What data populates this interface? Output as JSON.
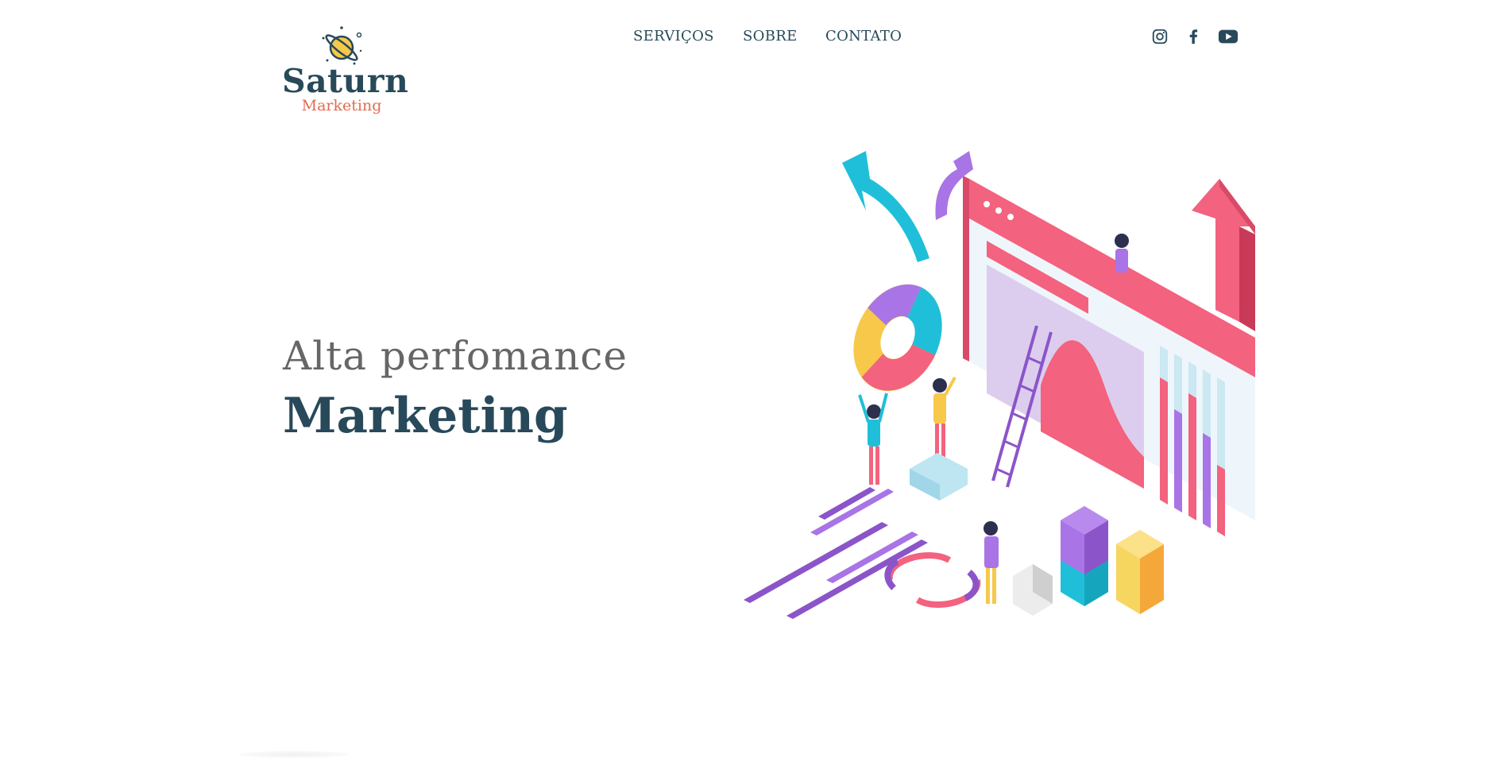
{
  "brand": {
    "name": "Saturn",
    "tagline": "Marketing",
    "colors": {
      "primary": "#28495a",
      "accent": "#e26b52",
      "planet": "#f7c84a"
    }
  },
  "nav": {
    "items": [
      {
        "label": "SERVIÇOS"
      },
      {
        "label": "SOBRE"
      },
      {
        "label": "CONTATO"
      }
    ]
  },
  "social": [
    {
      "icon": "instagram-icon"
    },
    {
      "icon": "facebook-icon"
    },
    {
      "icon": "youtube-icon"
    }
  ],
  "hero": {
    "line1": "Alta perfomance",
    "line2": "Marketing"
  }
}
